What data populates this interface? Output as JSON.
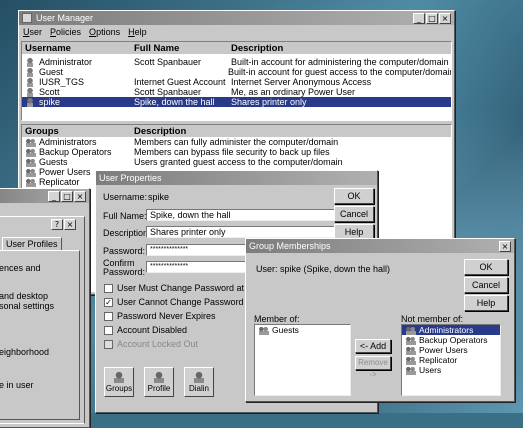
{
  "user_manager": {
    "title": "User Manager",
    "menu": [
      "User",
      "Policies",
      "Options",
      "Help"
    ],
    "user_columns": [
      "Username",
      "Full Name",
      "Description"
    ],
    "users": [
      {
        "username": "Administrator",
        "full_name": "Scott Spanbauer",
        "description": "Built-in account for administering the computer/domain"
      },
      {
        "username": "Guest",
        "full_name": "",
        "description": "Built-in account for guest access to the computer/domain"
      },
      {
        "username": "IUSR_TGS",
        "full_name": "Internet Guest Account",
        "description": "Internet Server Anonymous Access"
      },
      {
        "username": "Scott",
        "full_name": "Scott Spanbauer",
        "description": "Me, as an ordinary Power User"
      },
      {
        "username": "spike",
        "full_name": "Spike, down the hall",
        "description": "Shares printer only"
      }
    ],
    "group_columns": [
      "Groups",
      "Description"
    ],
    "groups": [
      {
        "name": "Administrators",
        "description": "Members can fully administer the computer/domain"
      },
      {
        "name": "Backup Operators",
        "description": "Members can bypass file security to back up files"
      },
      {
        "name": "Guests",
        "description": "Users granted guest access to the computer/domain"
      },
      {
        "name": "Power Users",
        "description": ""
      },
      {
        "name": "Replicator",
        "description": ""
      }
    ]
  },
  "left_window": {
    "tab": "User Profiles",
    "lines": [
      "ences and",
      "and desktop",
      "sonal settings",
      "eighborhood",
      "e in user"
    ]
  },
  "user_properties": {
    "title": "User Properties",
    "username_label": "Username:",
    "username_value": "spike",
    "full_name_label": "Full Name:",
    "full_name_value": "Spike, down the hall",
    "description_label": "Description:",
    "description_value": "Shares printer only",
    "password_label": "Password:",
    "password_value": "**************",
    "confirm_label_1": "Confirm",
    "confirm_label_2": "Password:",
    "confirm_value": "**************",
    "checkboxes": [
      {
        "label": "User Must Change Password at Next Logon",
        "checked": false,
        "disabled": false
      },
      {
        "label": "User Cannot Change Password",
        "checked": true,
        "disabled": false
      },
      {
        "label": "Password Never Expires",
        "checked": false,
        "disabled": false
      },
      {
        "label": "Account Disabled",
        "checked": false,
        "disabled": false
      },
      {
        "label": "Account Locked Out",
        "checked": false,
        "disabled": true
      }
    ],
    "ok": "OK",
    "cancel": "Cancel",
    "help": "Help",
    "bottom_buttons": [
      "Groups",
      "Profile",
      "Dialin"
    ]
  },
  "group_memberships": {
    "title": "Group Memberships",
    "user_label": "User:",
    "user_value": "spike (Spike, down the hall)",
    "ok": "OK",
    "cancel": "Cancel",
    "help": "Help",
    "member_of_label": "Member of:",
    "member_of": [
      "Guests"
    ],
    "not_member_of_label": "Not member of:",
    "not_member_of": [
      "Administrators",
      "Backup Operators",
      "Power Users",
      "Replicator",
      "Users"
    ],
    "add": "<- Add",
    "remove": "Remove ->"
  }
}
